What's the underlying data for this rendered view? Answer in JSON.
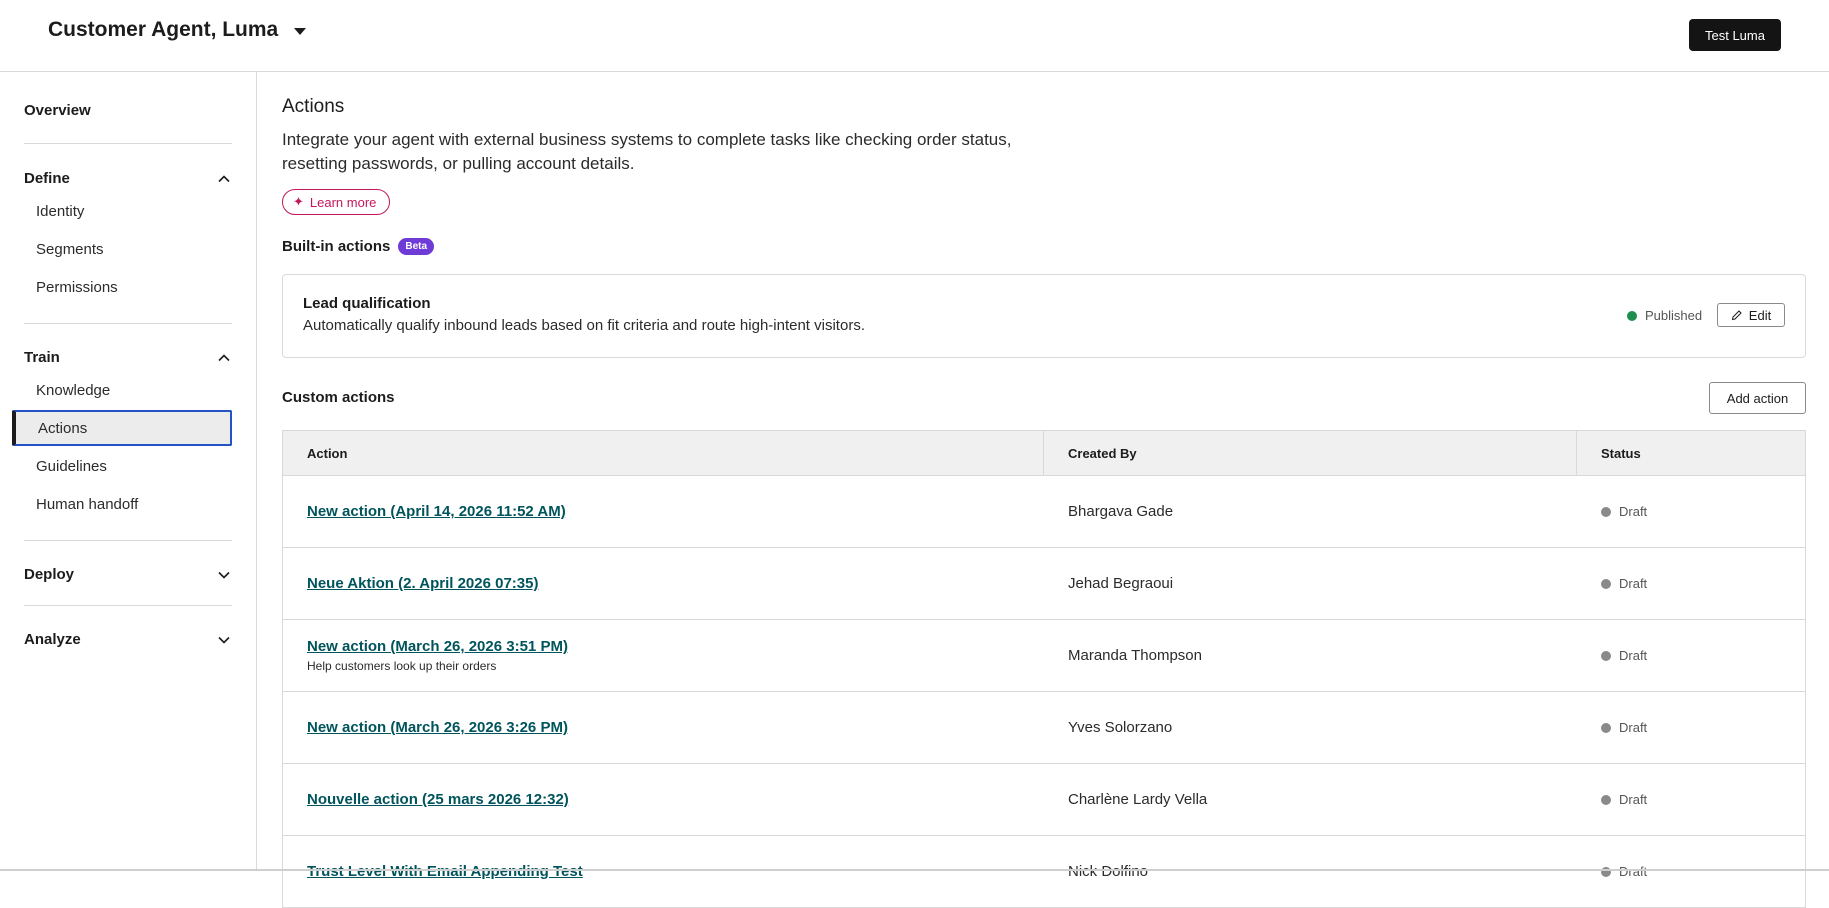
{
  "header": {
    "agent_title": "Customer Agent, Luma",
    "test_button": "Test Luma"
  },
  "sidebar": {
    "overview": "Overview",
    "sections": [
      {
        "label": "Define",
        "expanded": true,
        "items": [
          "Identity",
          "Segments",
          "Permissions"
        ]
      },
      {
        "label": "Train",
        "expanded": true,
        "items": [
          "Knowledge",
          "Actions",
          "Guidelines",
          "Human handoff"
        ]
      },
      {
        "label": "Deploy",
        "expanded": false,
        "items": []
      },
      {
        "label": "Analyze",
        "expanded": false,
        "items": []
      }
    ],
    "active_item": "Actions"
  },
  "main": {
    "title": "Actions",
    "description": "Integrate your agent with external business systems to complete tasks like checking order status, resetting passwords, or pulling account details.",
    "learn_more": "Learn more",
    "builtin": {
      "heading": "Built-in actions",
      "badge": "Beta",
      "card": {
        "title": "Lead qualification",
        "description": "Automatically qualify inbound leads based on fit criteria and route high-intent visitors.",
        "status": "Published",
        "edit_label": "Edit"
      }
    },
    "custom": {
      "heading": "Custom actions",
      "add_button": "Add action",
      "columns": [
        "Action",
        "Created By",
        "Status"
      ],
      "rows": [
        {
          "action": "New action (April 14, 2026 11:52 AM)",
          "subtitle": "",
          "created_by": "Bhargava Gade",
          "status": "Draft"
        },
        {
          "action": "Neue Aktion (2. April 2026 07:35)",
          "subtitle": "",
          "created_by": "Jehad Begraoui",
          "status": "Draft"
        },
        {
          "action": "New action (March 26, 2026 3:51 PM)",
          "subtitle": "Help customers look up their orders",
          "created_by": "Maranda Thompson",
          "status": "Draft"
        },
        {
          "action": "New action (March 26, 2026 3:26 PM)",
          "subtitle": "",
          "created_by": "Yves Solorzano",
          "status": "Draft"
        },
        {
          "action": "Nouvelle action (25 mars 2026 12:32)",
          "subtitle": "",
          "created_by": "Charlène Lardy Vella",
          "status": "Draft"
        },
        {
          "action": "Trust Level With Email Appending Test",
          "subtitle": "",
          "created_by": "Nick Dolfino",
          "status": "Draft"
        }
      ]
    }
  },
  "colors": {
    "accent_link": "#00545c",
    "beta_badge": "#6f3bd6",
    "learn_more": "#c2185b",
    "published_dot": "#1e8e4e",
    "draft_dot": "#8a8a8a",
    "active_outline": "#2453c4"
  },
  "icons": {
    "agent_dropdown": "caret-down-icon",
    "learn_more": "sparkle-icon",
    "edit": "pencil-icon",
    "section_expanded": "chevron-up-icon",
    "section_collapsed": "chevron-down-icon"
  }
}
